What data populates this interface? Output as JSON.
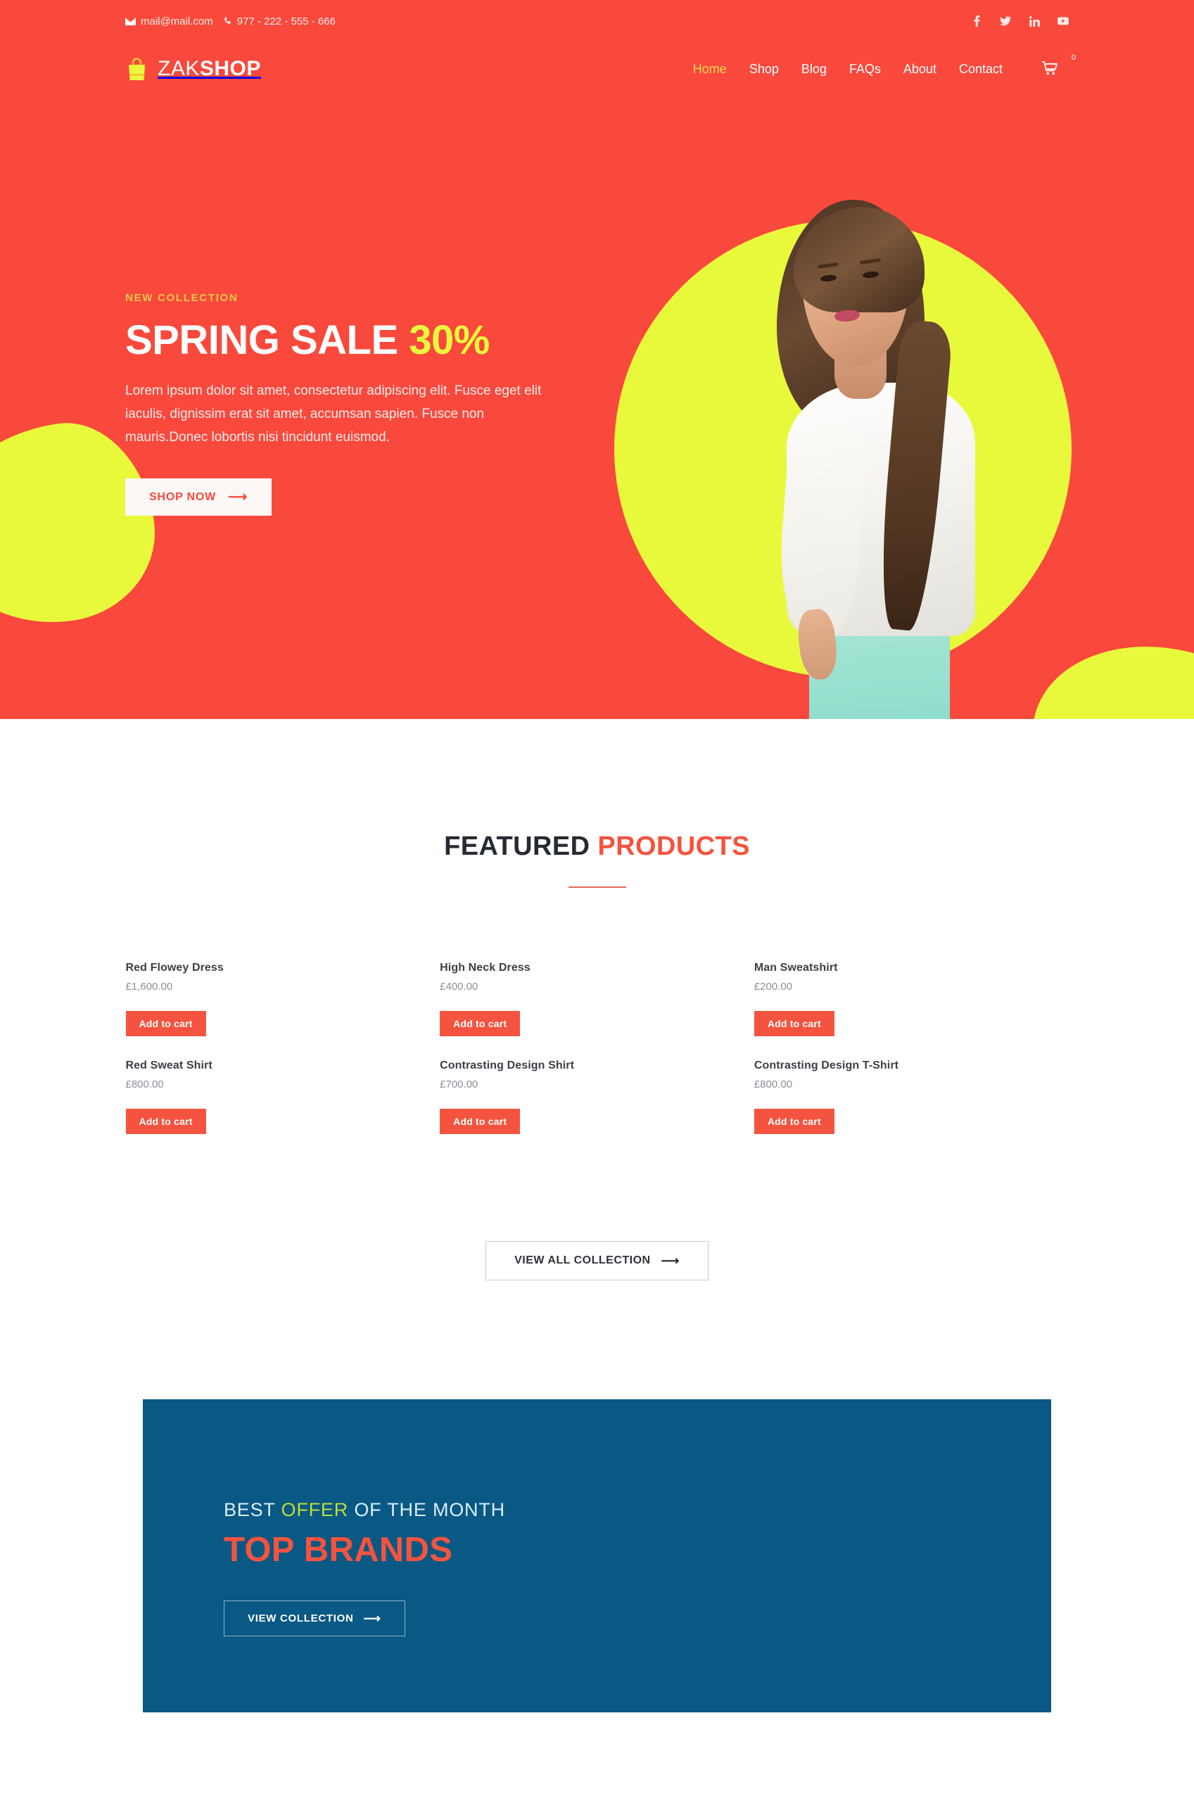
{
  "topbar": {
    "email": "mail@mail.com",
    "phone": "977 - 222 - 555 - 666",
    "email_icon": "envelope-icon",
    "phone_icon": "phone-icon",
    "socials": [
      {
        "name": "facebook-icon",
        "label": "Facebook"
      },
      {
        "name": "twitter-icon",
        "label": "Twitter"
      },
      {
        "name": "linkedin-icon",
        "label": "LinkedIn"
      },
      {
        "name": "youtube-icon",
        "label": "YouTube"
      }
    ]
  },
  "header": {
    "logo_icon": "shopping-bag-icon",
    "logo_first": "ZAK",
    "logo_second": "SHOP",
    "nav": [
      {
        "label": "Home",
        "active": true
      },
      {
        "label": "Shop",
        "active": false
      },
      {
        "label": "Blog",
        "active": false
      },
      {
        "label": "FAQs",
        "active": false
      },
      {
        "label": "About",
        "active": false
      },
      {
        "label": "Contact",
        "active": false
      }
    ],
    "cart_icon": "shopping-cart-icon",
    "cart_count": "0"
  },
  "hero": {
    "eyebrow": "NEW COLLECTION",
    "title_main": "SPRING SALE ",
    "title_highlight": "30%",
    "description": "Lorem ipsum dolor sit amet, consectetur adipiscing elit. Fusce eget elit iaculis, dignissim erat sit amet, accumsan sapien. Fusce non mauris.Donec lobortis nisi tincidunt euismod.",
    "cta_label": "SHOP NOW",
    "cta_arrow": "⟶"
  },
  "featured": {
    "title_dark": "FEATURED ",
    "title_highlight": "PRODUCTS",
    "products": [
      {
        "name": "Red Flowey Dress",
        "price": "£1,600.00",
        "cart_label": "Add to cart"
      },
      {
        "name": "High Neck Dress",
        "price": "£400.00",
        "cart_label": "Add to cart"
      },
      {
        "name": "Man Sweatshirt",
        "price": "£200.00",
        "cart_label": "Add to cart"
      },
      {
        "name": "Red Sweat Shirt",
        "price": "£800.00",
        "cart_label": "Add to cart"
      },
      {
        "name": "Contrasting Design Shirt",
        "price": "£700.00",
        "cart_label": "Add to cart"
      },
      {
        "name": "Contrasting Design T-Shirt",
        "price": "£800.00",
        "cart_label": "Add to cart"
      }
    ],
    "view_all_label": "VIEW ALL COLLECTION",
    "view_all_arrow": "⟶"
  },
  "offer": {
    "sub_before": "BEST ",
    "sub_highlight": "OFFER",
    "sub_after": " OF THE MONTH",
    "title": "TOP BRANDS",
    "cta_label": "VIEW COLLECTION",
    "cta_arrow": "⟶"
  },
  "colors": {
    "brand_red": "#f9493c",
    "accent_yellow": "#e8f93c",
    "product_red": "#f4543f",
    "offer_blue": "#0a5884",
    "nav_active": "#ffd84d"
  }
}
